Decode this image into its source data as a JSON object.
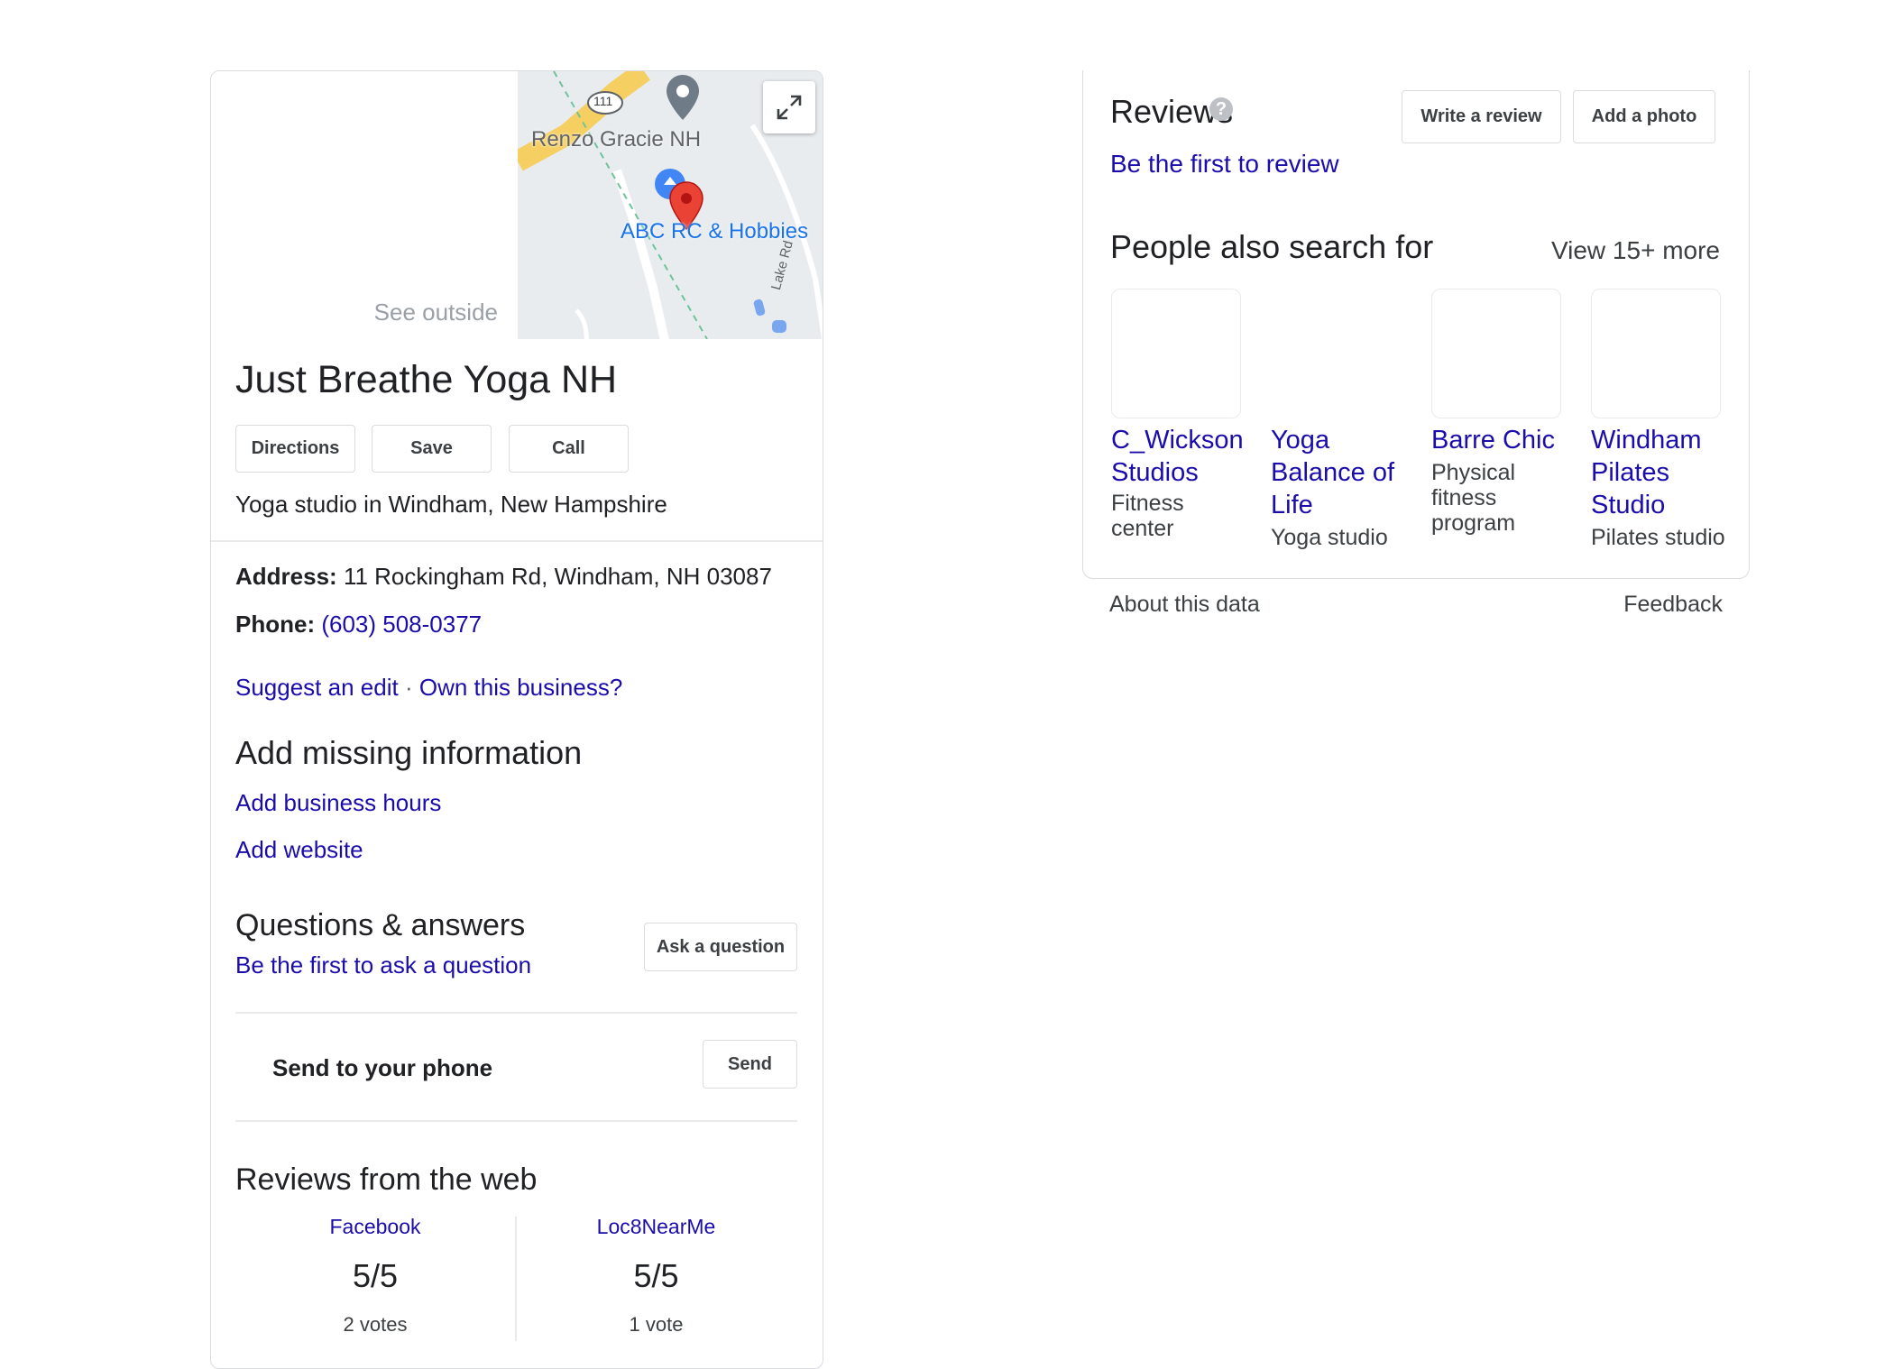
{
  "business": {
    "photo_overlay": "See outside",
    "map": {
      "route_shield": "111",
      "labels": [
        "Renzo Gracie NH",
        "ABC RC & Hobbies",
        "Lake Rd"
      ]
    },
    "name": "Just Breathe Yoga NH",
    "actions": [
      "Directions",
      "Save",
      "Call"
    ],
    "category": "Yoga studio in Windham, New Hampshire",
    "address_label": "Address:",
    "address": "11 Rockingham Rd, Windham, NH 03087",
    "phone_label": "Phone:",
    "phone": "(603) 508-0377",
    "suggest_edit": "Suggest an edit",
    "separator": "·",
    "own_business": "Own this business?"
  },
  "missing_info": {
    "title": "Add missing information",
    "links": [
      "Add business hours",
      "Add website"
    ]
  },
  "qa": {
    "title": "Questions & answers",
    "prompt": "Be the first to ask a question",
    "button": "Ask a question"
  },
  "send": {
    "label": "Send to your phone",
    "button": "Send"
  },
  "web_reviews": {
    "title": "Reviews from the web",
    "sources": [
      {
        "name": "Facebook",
        "score": "5/5",
        "votes": "2 votes"
      },
      {
        "name": "Loc8NearMe",
        "score": "5/5",
        "votes": "1 vote"
      }
    ]
  },
  "reviews": {
    "title": "Reviews",
    "help_icon": "?",
    "first_review": "Be the first to review",
    "write_button": "Write a review",
    "photo_button": "Add a photo"
  },
  "people_also_search": {
    "title": "People also search for",
    "more": "View 15+ more",
    "items": [
      {
        "name": "C_Wickson Studios",
        "category": "Fitness center"
      },
      {
        "name": "Yoga Balance of Life",
        "category": "Yoga studio"
      },
      {
        "name": "Barre Chic",
        "category": "Physical fitness program"
      },
      {
        "name": "Windham Pilates Studio",
        "category": "Pilates studio"
      }
    ]
  },
  "footer": {
    "about": "About this data",
    "feedback": "Feedback"
  },
  "colors": {
    "link": "#1a0dab",
    "border": "#dadce0",
    "text": "#202124",
    "map_pin": "#ea4335",
    "map_road": "#f6d26a"
  }
}
